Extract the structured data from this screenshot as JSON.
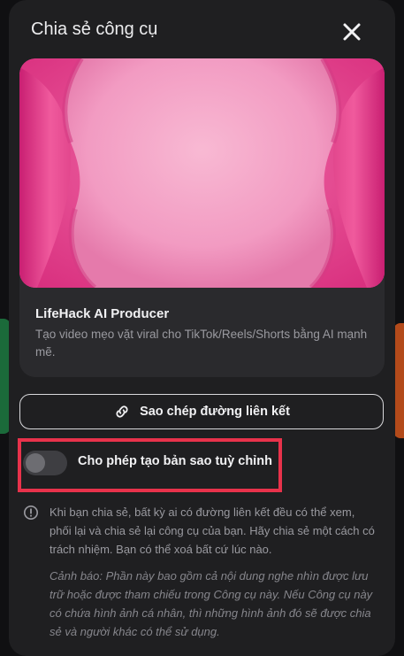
{
  "dialog": {
    "title": "Chia sẻ công cụ",
    "close_icon": "close-icon"
  },
  "tool_card": {
    "name": "LifeHack AI Producer",
    "description": "Tạo video mẹo vặt viral cho TikTok/Reels/Shorts bằng AI mạnh mẽ.",
    "image_colors": {
      "primary": "#e94b95",
      "light": "#f5a6c8",
      "dark": "#b8246d"
    }
  },
  "copy_link": {
    "label": "Sao chép đường liên kết",
    "icon": "link-icon"
  },
  "remix_toggle": {
    "label": "Cho phép tạo bản sao tuỳ chỉnh",
    "enabled": false,
    "highlight_color": "#e8324b"
  },
  "info": {
    "icon": "info-icon",
    "text": "Khi bạn chia sẻ, bất kỳ ai có đường liên kết đều có thể xem, phối lại và chia sẻ lại công cụ của bạn. Hãy chia sẻ một cách có trách nhiệm. Bạn có thể xoá bất cứ lúc nào.",
    "warning": "Cảnh báo: Phần này bao gồm cả nội dung nghe nhìn được lưu trữ hoặc được tham chiếu trong Công cụ này. Nếu Công cụ này có chứa hình ảnh cá nhân, thì những hình ảnh đó sẽ được chia sẻ và người khác có thể sử dụng."
  }
}
